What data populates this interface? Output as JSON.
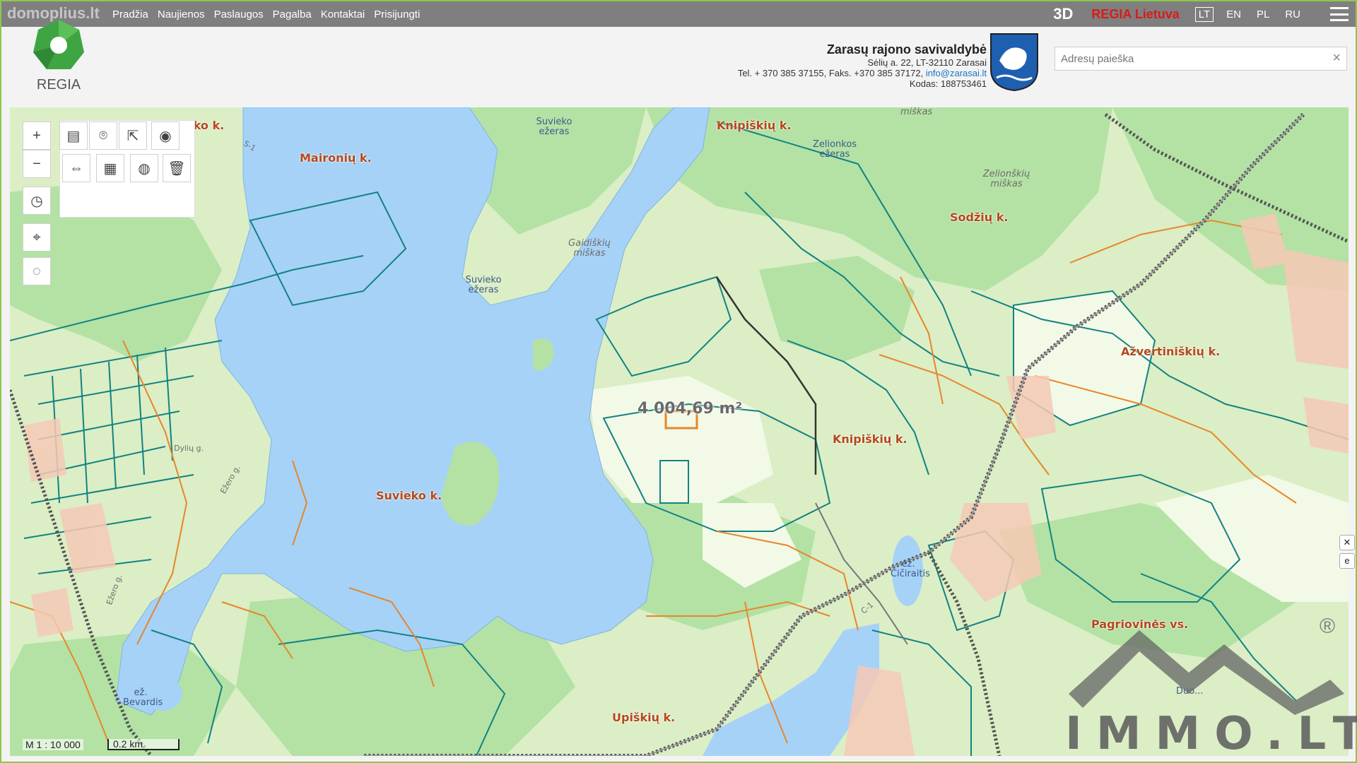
{
  "watermark": "domoplius.lt",
  "nav": [
    "Pradžia",
    "Naujienos",
    "Paslaugos",
    "Pagalba",
    "Kontaktai",
    "Prisijungti"
  ],
  "top_right": {
    "btn_3d": "3D",
    "regia_lietuva": "REGIA Lietuva",
    "languages": [
      "LT",
      "EN",
      "PL",
      "RU"
    ],
    "active_language": "LT"
  },
  "logo_text": "REGIA",
  "municipality": {
    "name": "Zarasų rajono savivaldybė",
    "address": "Sėlių a. 22, LT-32110 Zarasai",
    "phone": "Tel. + 370 385 37155, Faks. +370 385 37172, ",
    "email": "info@zarasai.lt",
    "code": "Kodas: 188753461"
  },
  "search": {
    "placeholder": "Adresų paieška",
    "clear": "×"
  },
  "map": {
    "villages": [
      "Suvieko k.",
      "Maironių k.",
      "Knipiškių k.",
      "Sodžių k.",
      "Ažvertiniškių k.",
      "Knipiškių k.",
      "Suvieko k.",
      "Pagriovinės vs.",
      "Upiškių k."
    ],
    "waters": [
      "Suvieko ežeras",
      "Suvieko ežeras",
      "Zelionkos ežeras",
      "ež. Čičiraitis",
      "ež. Bevardis",
      "Duo..."
    ],
    "forests": [
      "Gaidiškių miškas",
      "Zelionškių miškas",
      "miškas"
    ],
    "roads": [
      "Dylių g.",
      "Ežero g.",
      "Ežero g.",
      "C-1",
      "S-1"
    ],
    "measured_area": "4 004,69 m²"
  },
  "scale": {
    "ratio": "M 1 : 10 000",
    "bar": "0.2 km"
  },
  "side_icons": [
    "close-icon",
    "e-icon"
  ],
  "overlay_logo": {
    "text": "IMMO.LT",
    "mark": "®"
  },
  "colors": {
    "water": "#a6d2f7",
    "land": "#dbeec5",
    "forest": "#a8dc9a",
    "parcel_teal": "#0f8080",
    "parcel_orange": "#e8862a",
    "railway": "#666666"
  }
}
